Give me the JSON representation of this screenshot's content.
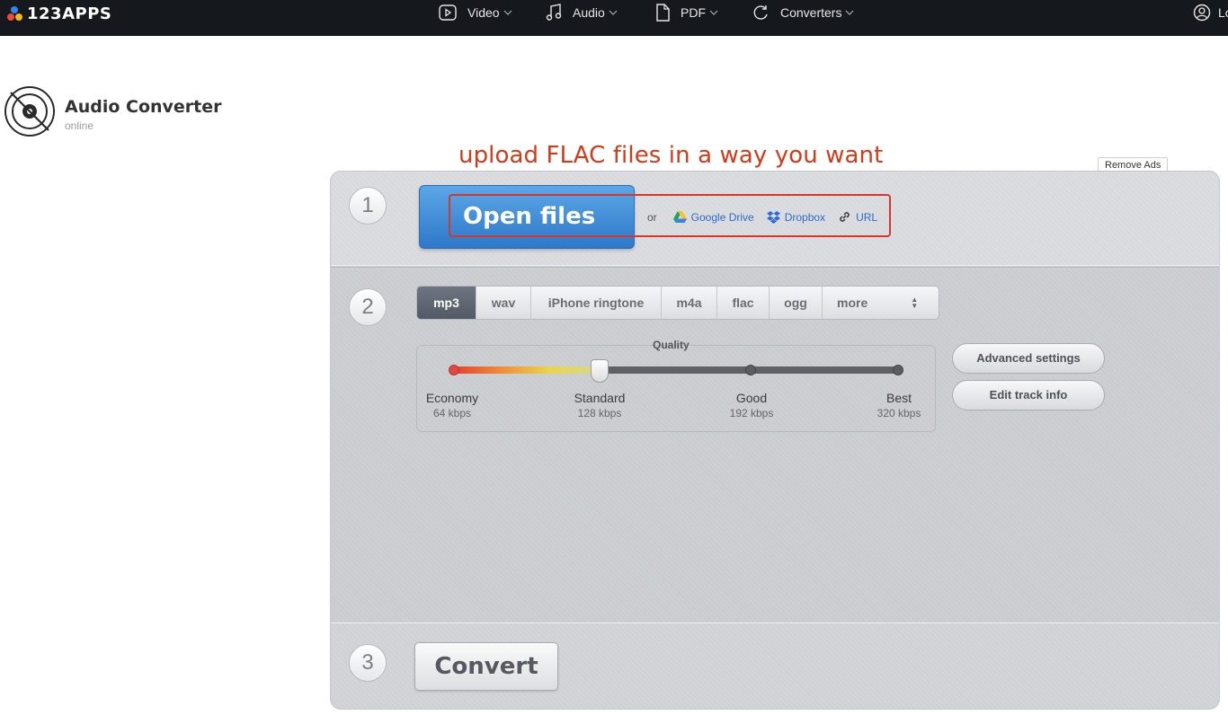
{
  "topbar": {
    "logo_text": "123APPS",
    "nav": [
      {
        "label": "Video",
        "icon": "video-icon"
      },
      {
        "label": "Audio",
        "icon": "music-note-icon"
      },
      {
        "label": "PDF",
        "icon": "document-icon"
      },
      {
        "label": "Converters",
        "icon": "refresh-icon"
      }
    ],
    "login_label": "Lo"
  },
  "brand": {
    "title": "Audio Converter",
    "subtitle": "online",
    "icon": "disc-icon"
  },
  "headline": "upload FLAC files in a way you want",
  "remove_ads": "Remove Ads",
  "step1": {
    "number": "1",
    "open_files": "Open files",
    "or": "or",
    "sources": [
      {
        "label": "Google Drive",
        "icon": "google-drive-icon"
      },
      {
        "label": "Dropbox",
        "icon": "dropbox-icon"
      },
      {
        "label": "URL",
        "icon": "link-icon"
      }
    ]
  },
  "step2": {
    "number": "2",
    "formats": [
      "mp3",
      "wav",
      "iPhone ringtone",
      "m4a",
      "flac",
      "ogg",
      "more"
    ],
    "selected_format": "mp3",
    "quality": {
      "label": "Quality",
      "levels": [
        {
          "name": "Economy",
          "bitrate": "64 kbps"
        },
        {
          "name": "Standard",
          "bitrate": "128 kbps"
        },
        {
          "name": "Good",
          "bitrate": "192 kbps"
        },
        {
          "name": "Best",
          "bitrate": "320 kbps"
        }
      ],
      "selected": "Standard"
    },
    "advanced_settings": "Advanced settings",
    "edit_track_info": "Edit track info"
  },
  "step3": {
    "number": "3",
    "convert": "Convert"
  },
  "colors": {
    "topbar_bg": "#15181d",
    "headline": "#d43a17",
    "open_button": "#3a86d6",
    "link": "#2d6bc4",
    "highlight": "#d6372a"
  }
}
